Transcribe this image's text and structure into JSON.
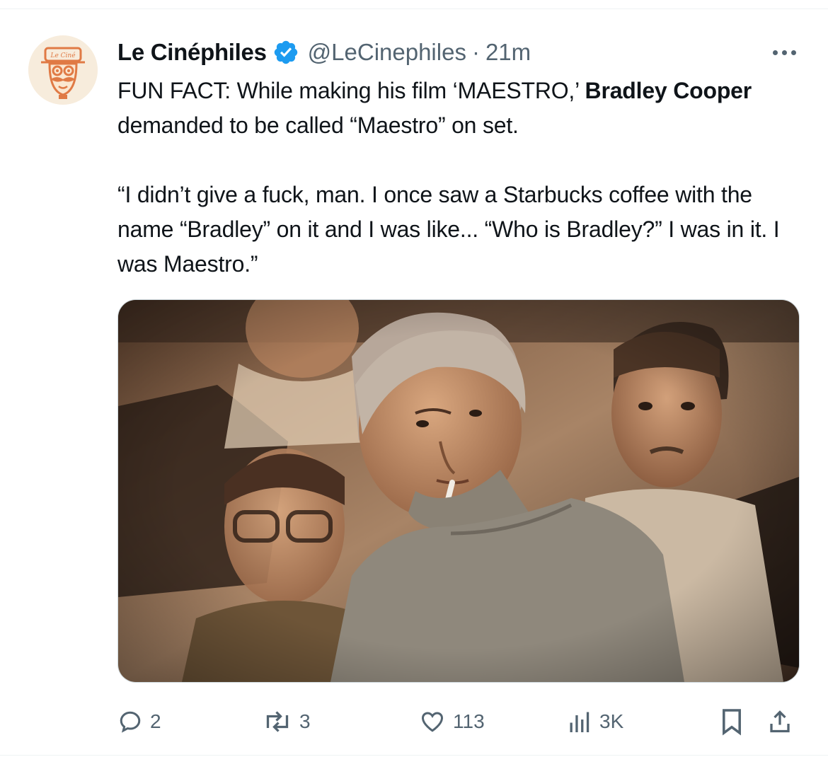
{
  "tweet": {
    "author_name": "Le Cinéphiles",
    "handle": "@LeCinephiles",
    "separator": "·",
    "time": "21m",
    "avatar_text": "Le Ciné",
    "text": {
      "p1_a": "FUN FACT: While making his film ‘MAESTRO,’ ",
      "p1_b": "Bradley Cooper",
      "p1_c": " demanded to be called “Maestro” on set.",
      "p2": "“I didn’t give a fuck, man. I once saw a Starbucks coffee with the name “Bradley” on it and I was like... “Who is Bradley?” I was in it. I was Maestro.”"
    },
    "media": {
      "image": "film-still-conductor-with-cigarette"
    }
  },
  "actions": {
    "replies": "2",
    "reposts": "3",
    "likes": "113",
    "views": "3K"
  },
  "icons": {
    "verified": "verified-badge-icon",
    "more": "more-dots-icon",
    "reply": "reply-icon",
    "repost": "repost-icon",
    "like": "heart-icon",
    "views": "views-chart-icon",
    "bookmark": "bookmark-icon",
    "share": "share-icon"
  },
  "colors": {
    "text": "#0f1419",
    "secondary": "#536471",
    "verified": "#1d9bf0",
    "avatar_bg": "#f7ecdc",
    "avatar_accent": "#e07a45"
  }
}
